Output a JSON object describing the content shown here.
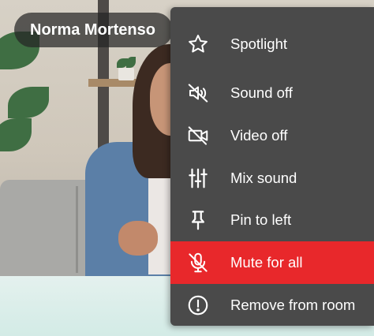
{
  "participant": {
    "name": "Norma Mortenso"
  },
  "menu": {
    "items": [
      {
        "label": "Spotlight",
        "icon": "star-outline-icon"
      },
      {
        "label": "Sound off",
        "icon": "speaker-muted-icon"
      },
      {
        "label": "Video off",
        "icon": "camera-off-icon"
      },
      {
        "label": "Mix sound",
        "icon": "sliders-icon"
      },
      {
        "label": "Pin to left",
        "icon": "pin-icon"
      },
      {
        "label": "Mute for all",
        "icon": "microphone-off-icon",
        "highlighted": true
      },
      {
        "label": "Remove from room",
        "icon": "exclamation-circle-icon"
      }
    ]
  },
  "colors": {
    "menu_bg": "#4a4a4a",
    "highlight": "#e8282b",
    "text": "#ffffff"
  }
}
